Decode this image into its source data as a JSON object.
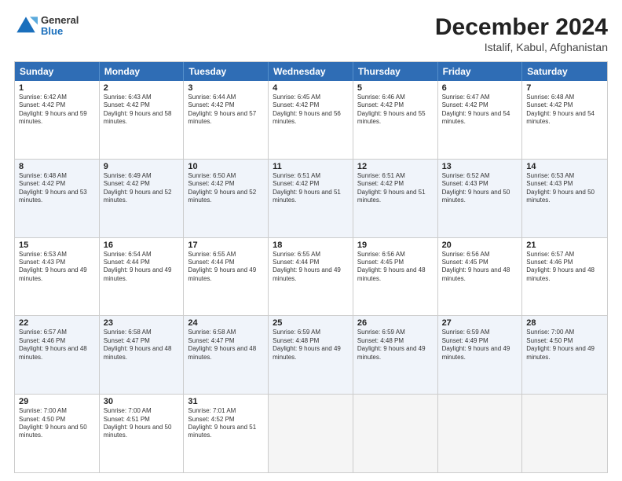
{
  "header": {
    "logo_general": "General",
    "logo_blue": "Blue",
    "title": "December 2024",
    "subtitle": "Istalif, Kabul, Afghanistan"
  },
  "days_of_week": [
    "Sunday",
    "Monday",
    "Tuesday",
    "Wednesday",
    "Thursday",
    "Friday",
    "Saturday"
  ],
  "weeks": [
    [
      {
        "day": "1",
        "sunrise": "Sunrise: 6:42 AM",
        "sunset": "Sunset: 4:42 PM",
        "daylight": "Daylight: 9 hours and 59 minutes."
      },
      {
        "day": "2",
        "sunrise": "Sunrise: 6:43 AM",
        "sunset": "Sunset: 4:42 PM",
        "daylight": "Daylight: 9 hours and 58 minutes."
      },
      {
        "day": "3",
        "sunrise": "Sunrise: 6:44 AM",
        "sunset": "Sunset: 4:42 PM",
        "daylight": "Daylight: 9 hours and 57 minutes."
      },
      {
        "day": "4",
        "sunrise": "Sunrise: 6:45 AM",
        "sunset": "Sunset: 4:42 PM",
        "daylight": "Daylight: 9 hours and 56 minutes."
      },
      {
        "day": "5",
        "sunrise": "Sunrise: 6:46 AM",
        "sunset": "Sunset: 4:42 PM",
        "daylight": "Daylight: 9 hours and 55 minutes."
      },
      {
        "day": "6",
        "sunrise": "Sunrise: 6:47 AM",
        "sunset": "Sunset: 4:42 PM",
        "daylight": "Daylight: 9 hours and 54 minutes."
      },
      {
        "day": "7",
        "sunrise": "Sunrise: 6:48 AM",
        "sunset": "Sunset: 4:42 PM",
        "daylight": "Daylight: 9 hours and 54 minutes."
      }
    ],
    [
      {
        "day": "8",
        "sunrise": "Sunrise: 6:48 AM",
        "sunset": "Sunset: 4:42 PM",
        "daylight": "Daylight: 9 hours and 53 minutes."
      },
      {
        "day": "9",
        "sunrise": "Sunrise: 6:49 AM",
        "sunset": "Sunset: 4:42 PM",
        "daylight": "Daylight: 9 hours and 52 minutes."
      },
      {
        "day": "10",
        "sunrise": "Sunrise: 6:50 AM",
        "sunset": "Sunset: 4:42 PM",
        "daylight": "Daylight: 9 hours and 52 minutes."
      },
      {
        "day": "11",
        "sunrise": "Sunrise: 6:51 AM",
        "sunset": "Sunset: 4:42 PM",
        "daylight": "Daylight: 9 hours and 51 minutes."
      },
      {
        "day": "12",
        "sunrise": "Sunrise: 6:51 AM",
        "sunset": "Sunset: 4:42 PM",
        "daylight": "Daylight: 9 hours and 51 minutes."
      },
      {
        "day": "13",
        "sunrise": "Sunrise: 6:52 AM",
        "sunset": "Sunset: 4:43 PM",
        "daylight": "Daylight: 9 hours and 50 minutes."
      },
      {
        "day": "14",
        "sunrise": "Sunrise: 6:53 AM",
        "sunset": "Sunset: 4:43 PM",
        "daylight": "Daylight: 9 hours and 50 minutes."
      }
    ],
    [
      {
        "day": "15",
        "sunrise": "Sunrise: 6:53 AM",
        "sunset": "Sunset: 4:43 PM",
        "daylight": "Daylight: 9 hours and 49 minutes."
      },
      {
        "day": "16",
        "sunrise": "Sunrise: 6:54 AM",
        "sunset": "Sunset: 4:44 PM",
        "daylight": "Daylight: 9 hours and 49 minutes."
      },
      {
        "day": "17",
        "sunrise": "Sunrise: 6:55 AM",
        "sunset": "Sunset: 4:44 PM",
        "daylight": "Daylight: 9 hours and 49 minutes."
      },
      {
        "day": "18",
        "sunrise": "Sunrise: 6:55 AM",
        "sunset": "Sunset: 4:44 PM",
        "daylight": "Daylight: 9 hours and 49 minutes."
      },
      {
        "day": "19",
        "sunrise": "Sunrise: 6:56 AM",
        "sunset": "Sunset: 4:45 PM",
        "daylight": "Daylight: 9 hours and 48 minutes."
      },
      {
        "day": "20",
        "sunrise": "Sunrise: 6:56 AM",
        "sunset": "Sunset: 4:45 PM",
        "daylight": "Daylight: 9 hours and 48 minutes."
      },
      {
        "day": "21",
        "sunrise": "Sunrise: 6:57 AM",
        "sunset": "Sunset: 4:46 PM",
        "daylight": "Daylight: 9 hours and 48 minutes."
      }
    ],
    [
      {
        "day": "22",
        "sunrise": "Sunrise: 6:57 AM",
        "sunset": "Sunset: 4:46 PM",
        "daylight": "Daylight: 9 hours and 48 minutes."
      },
      {
        "day": "23",
        "sunrise": "Sunrise: 6:58 AM",
        "sunset": "Sunset: 4:47 PM",
        "daylight": "Daylight: 9 hours and 48 minutes."
      },
      {
        "day": "24",
        "sunrise": "Sunrise: 6:58 AM",
        "sunset": "Sunset: 4:47 PM",
        "daylight": "Daylight: 9 hours and 48 minutes."
      },
      {
        "day": "25",
        "sunrise": "Sunrise: 6:59 AM",
        "sunset": "Sunset: 4:48 PM",
        "daylight": "Daylight: 9 hours and 49 minutes."
      },
      {
        "day": "26",
        "sunrise": "Sunrise: 6:59 AM",
        "sunset": "Sunset: 4:48 PM",
        "daylight": "Daylight: 9 hours and 49 minutes."
      },
      {
        "day": "27",
        "sunrise": "Sunrise: 6:59 AM",
        "sunset": "Sunset: 4:49 PM",
        "daylight": "Daylight: 9 hours and 49 minutes."
      },
      {
        "day": "28",
        "sunrise": "Sunrise: 7:00 AM",
        "sunset": "Sunset: 4:50 PM",
        "daylight": "Daylight: 9 hours and 49 minutes."
      }
    ],
    [
      {
        "day": "29",
        "sunrise": "Sunrise: 7:00 AM",
        "sunset": "Sunset: 4:50 PM",
        "daylight": "Daylight: 9 hours and 50 minutes."
      },
      {
        "day": "30",
        "sunrise": "Sunrise: 7:00 AM",
        "sunset": "Sunset: 4:51 PM",
        "daylight": "Daylight: 9 hours and 50 minutes."
      },
      {
        "day": "31",
        "sunrise": "Sunrise: 7:01 AM",
        "sunset": "Sunset: 4:52 PM",
        "daylight": "Daylight: 9 hours and 51 minutes."
      },
      {
        "day": "",
        "sunrise": "",
        "sunset": "",
        "daylight": ""
      },
      {
        "day": "",
        "sunrise": "",
        "sunset": "",
        "daylight": ""
      },
      {
        "day": "",
        "sunrise": "",
        "sunset": "",
        "daylight": ""
      },
      {
        "day": "",
        "sunrise": "",
        "sunset": "",
        "daylight": ""
      }
    ]
  ]
}
